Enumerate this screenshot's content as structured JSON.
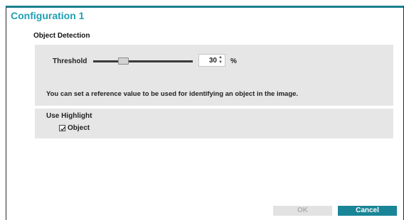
{
  "dialog": {
    "title": "Configuration 1"
  },
  "object_detection": {
    "heading": "Object Detection",
    "threshold_label": "Threshold",
    "threshold_value": "30",
    "threshold_unit": "%",
    "slider_fraction": 0.3,
    "info_text": "You can set a reference value to be used for identifying an object in the image.",
    "spin_up_glyph": "▲",
    "spin_down_glyph": "▼"
  },
  "highlight": {
    "label": "Use Highlight",
    "object_label": "Object",
    "object_checked": true
  },
  "buttons": {
    "ok_label": "OK",
    "ok_enabled": false,
    "cancel_label": "Cancel"
  },
  "colors": {
    "accent": "#1f9fb3",
    "primary_button": "#1a8597",
    "panel_background": "#e6e6e6",
    "top_border": "#1a7f8e"
  },
  "icons": {
    "spin_up": "spin-up-icon",
    "spin_down": "spin-down-icon",
    "checkmark": "checkmark-icon"
  }
}
